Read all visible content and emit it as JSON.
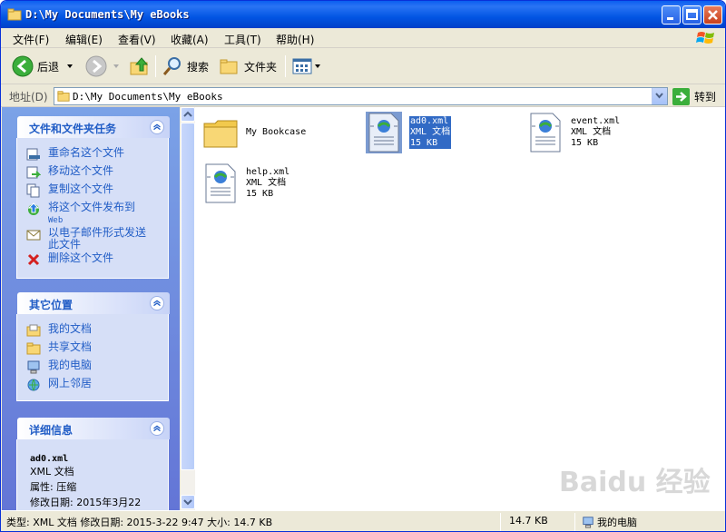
{
  "window": {
    "title": "D:\\My Documents\\My eBooks"
  },
  "menu": [
    "文件(F)",
    "编辑(E)",
    "查看(V)",
    "收藏(A)",
    "工具(T)",
    "帮助(H)"
  ],
  "toolbar": {
    "back": "后退",
    "search": "搜索",
    "folders": "文件夹"
  },
  "address": {
    "label": "地址(D)",
    "value": "D:\\My Documents\\My eBooks",
    "go": "转到"
  },
  "tasks": {
    "title": "文件和文件夹任务",
    "items": [
      "重命名这个文件",
      "移动这个文件",
      "复制这个文件",
      "将这个文件发布到",
      "Web",
      "以电子邮件形式发送",
      "此文件",
      "删除这个文件"
    ]
  },
  "places": {
    "title": "其它位置",
    "items": [
      "我的文档",
      "共享文档",
      "我的电脑",
      "网上邻居"
    ]
  },
  "details": {
    "title": "详细信息",
    "name": "ad0.xml",
    "type": "XML 文档",
    "attr": "属性: 压缩",
    "modified": "修改日期: 2015年3月22"
  },
  "files": [
    {
      "name": "My Bookcase"
    },
    {
      "name": "ad0.xml",
      "type": "XML 文档",
      "size": "15 KB"
    },
    {
      "name": "event.xml",
      "type": "XML 文档",
      "size": "15 KB"
    },
    {
      "name": "help.xml",
      "type": "XML 文档",
      "size": "15 KB"
    }
  ],
  "status": {
    "info": "类型: XML 文档 修改日期: 2015-3-22 9:47 大小: 14.7 KB",
    "size": "14.7 KB",
    "location": "我的电脑"
  },
  "watermark": "Baidu 经验"
}
